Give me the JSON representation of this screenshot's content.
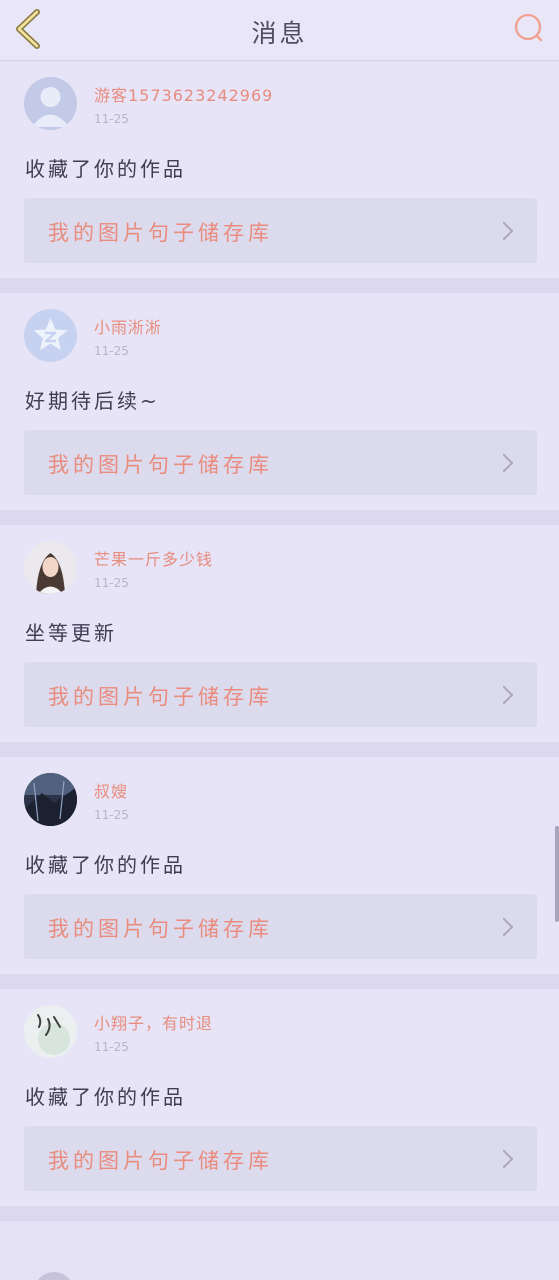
{
  "header": {
    "title": "消息",
    "back_icon": "chevron-left-icon",
    "search_icon": "search-icon",
    "accent_color": "#e88c7e"
  },
  "messages": [
    {
      "username": "游客1573623242969",
      "time": "11-25",
      "content": "收藏了你的作品",
      "work_title": "我的图片句子储存库",
      "avatar": "default-user-avatar-icon"
    },
    {
      "username": "小雨淅淅",
      "time": "11-25",
      "content": "好期待后续~",
      "work_title": "我的图片句子储存库",
      "avatar": "qzone-star-avatar-icon"
    },
    {
      "username": "芒果一斤多少钱",
      "time": "11-25",
      "content": "坐等更新",
      "work_title": "我的图片句子储存库",
      "avatar": "girl-photo-avatar"
    },
    {
      "username": "叔嫂",
      "time": "11-25",
      "content": "收藏了你的作品",
      "work_title": "我的图片句子储存库",
      "avatar": "night-scene-avatar"
    },
    {
      "username": "小翔子，有时退",
      "time": "11-25",
      "content": "收藏了你的作品",
      "work_title": "我的图片句子储存库",
      "avatar": "calligraphy-avatar"
    }
  ]
}
